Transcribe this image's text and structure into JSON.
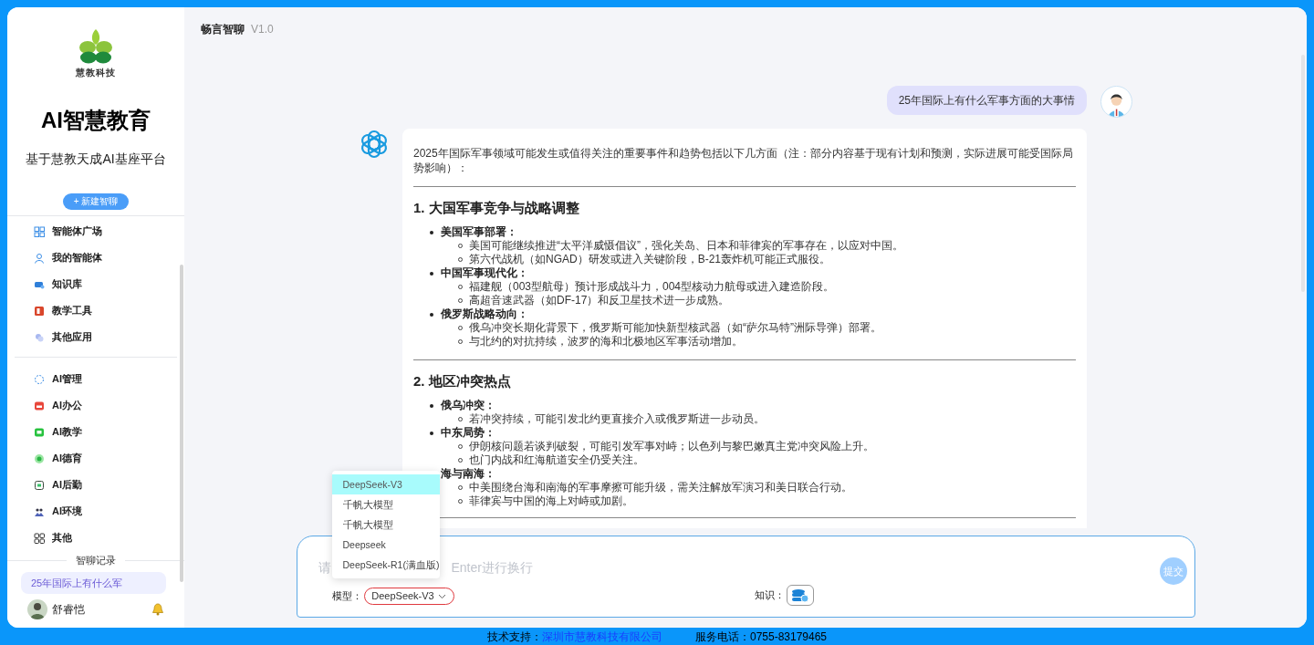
{
  "sidebar": {
    "logo_caption": "慧教科技",
    "title": "AI智慧教育",
    "subtitle": "基于慧教天成AI基座平台",
    "new_chat_button": "+ 新建智聊",
    "menu_groups": [
      [
        {
          "label": "智能体广场"
        },
        {
          "label": "我的智能体"
        },
        {
          "label": "知识库"
        },
        {
          "label": "教学工具"
        },
        {
          "label": "其他应用"
        }
      ],
      [
        {
          "label": "AI管理"
        },
        {
          "label": "AI办公"
        },
        {
          "label": "AI教学"
        },
        {
          "label": "AI德育"
        },
        {
          "label": "AI后勤"
        },
        {
          "label": "AI环境"
        },
        {
          "label": "其他"
        }
      ]
    ],
    "history_heading": "智聊记录",
    "history": [
      {
        "label": "25年国际上有什么军",
        "selected": true
      }
    ],
    "user": {
      "name": "舒睿恺"
    }
  },
  "header": {
    "title": "畅言智聊",
    "version": "V1.0"
  },
  "messages": [
    {
      "kind": "user",
      "text": "25年国际上有什么军事方面的大事情"
    },
    {
      "kind": "assistant",
      "intro": "2025年国际军事领域可能发生或值得关注的重要事件和趋势包括以下几方面（注：部分内容基于现有计划和预测，实际进展可能受国际局势影响）：",
      "sections": [
        {
          "heading": "1. 大国军事竞争与战略调整",
          "items": [
            {
              "label": "美国军事部署：",
              "points": [
                "美国可能继续推进“太平洋威慑倡议”，强化关岛、日本和菲律宾的军事存在，以应对中国。",
                "第六代战机（如NGAD）研发或进入关键阶段，B-21轰炸机可能正式服役。"
              ]
            },
            {
              "label": "中国军事现代化：",
              "points": [
                "福建舰（003型航母）预计形成战斗力，004型核动力航母或进入建造阶段。",
                "高超音速武器（如DF-17）和反卫星技术进一步成熟。"
              ]
            },
            {
              "label": "俄罗斯战略动向：",
              "points": [
                "俄乌冲突长期化背景下，俄罗斯可能加快新型核武器（如“萨尔马特”洲际导弹）部署。",
                "与北约的对抗持续，波罗的海和北极地区军事活动增加。"
              ]
            }
          ]
        },
        {
          "heading": "2. 地区冲突热点",
          "items": [
            {
              "label": "俄乌冲突：",
              "points": [
                "若冲突持续，可能引发北约更直接介入或俄罗斯进一步动员。"
              ]
            },
            {
              "label": "中东局势：",
              "points": [
                "伊朗核问题若谈判破裂，可能引发军事对峙；以色列与黎巴嫩真主党冲突风险上升。",
                "也门内战和红海航道安全仍受关注。"
              ]
            },
            {
              "label": "海与南海：",
              "points": [
                "中美围绕台海和南海的军事摩擦可能升级，需关注解放军演习和美日联合行动。",
                "菲律宾与中国的海上对峙或加剧。"
              ]
            }
          ]
        }
      ]
    }
  ],
  "composer": {
    "placeholder_start": "请",
    "placeholder_end": "Enter进行换行",
    "model_label": "模型：",
    "model_value": "DeepSeek-V3",
    "knowledge_label": "知识：",
    "submit": "提交",
    "model_menu": [
      {
        "label": "DeepSeek-V3",
        "selected": true
      },
      {
        "label": "千帆大模型",
        "selected": false
      },
      {
        "label": "千帆大模型",
        "selected": false
      },
      {
        "label": "Deepseek",
        "selected": false
      },
      {
        "label": "DeepSeek-R1(满血版)",
        "selected": false
      }
    ]
  },
  "footer": {
    "support_label": "技术支持：",
    "company": "深圳市慧教科技有限公司",
    "phone": "服务电话：0755-83179465"
  }
}
